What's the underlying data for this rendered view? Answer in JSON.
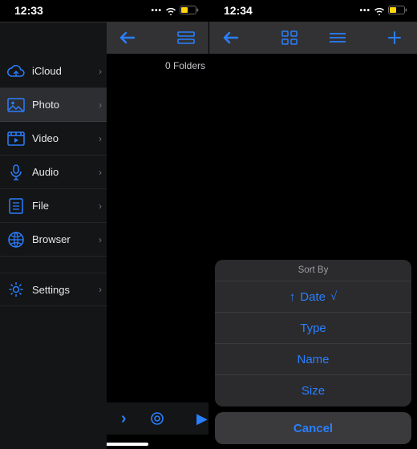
{
  "colors": {
    "accent": "#2a7fff",
    "panel": "#141516",
    "sheet": "#2b2b2d"
  },
  "left": {
    "status": {
      "time": "12:33"
    },
    "folder_count": "0 Folders",
    "sidebar": {
      "items": [
        {
          "icon": "cloud-icon",
          "label": "iCloud"
        },
        {
          "icon": "photo-icon",
          "label": "Photo",
          "active": true
        },
        {
          "icon": "video-icon",
          "label": "Video"
        },
        {
          "icon": "audio-icon",
          "label": "Audio"
        },
        {
          "icon": "file-icon",
          "label": "File"
        },
        {
          "icon": "globe-icon",
          "label": "Browser"
        },
        {
          "icon": "gear-icon",
          "label": "Settings",
          "separated": true
        }
      ]
    }
  },
  "right": {
    "status": {
      "time": "12:34"
    },
    "sheet": {
      "title": "Sort By",
      "options": [
        {
          "label": "Date",
          "selected": true,
          "direction": "asc"
        },
        {
          "label": "Type"
        },
        {
          "label": "Name"
        },
        {
          "label": "Size"
        }
      ],
      "cancel": "Cancel"
    }
  }
}
